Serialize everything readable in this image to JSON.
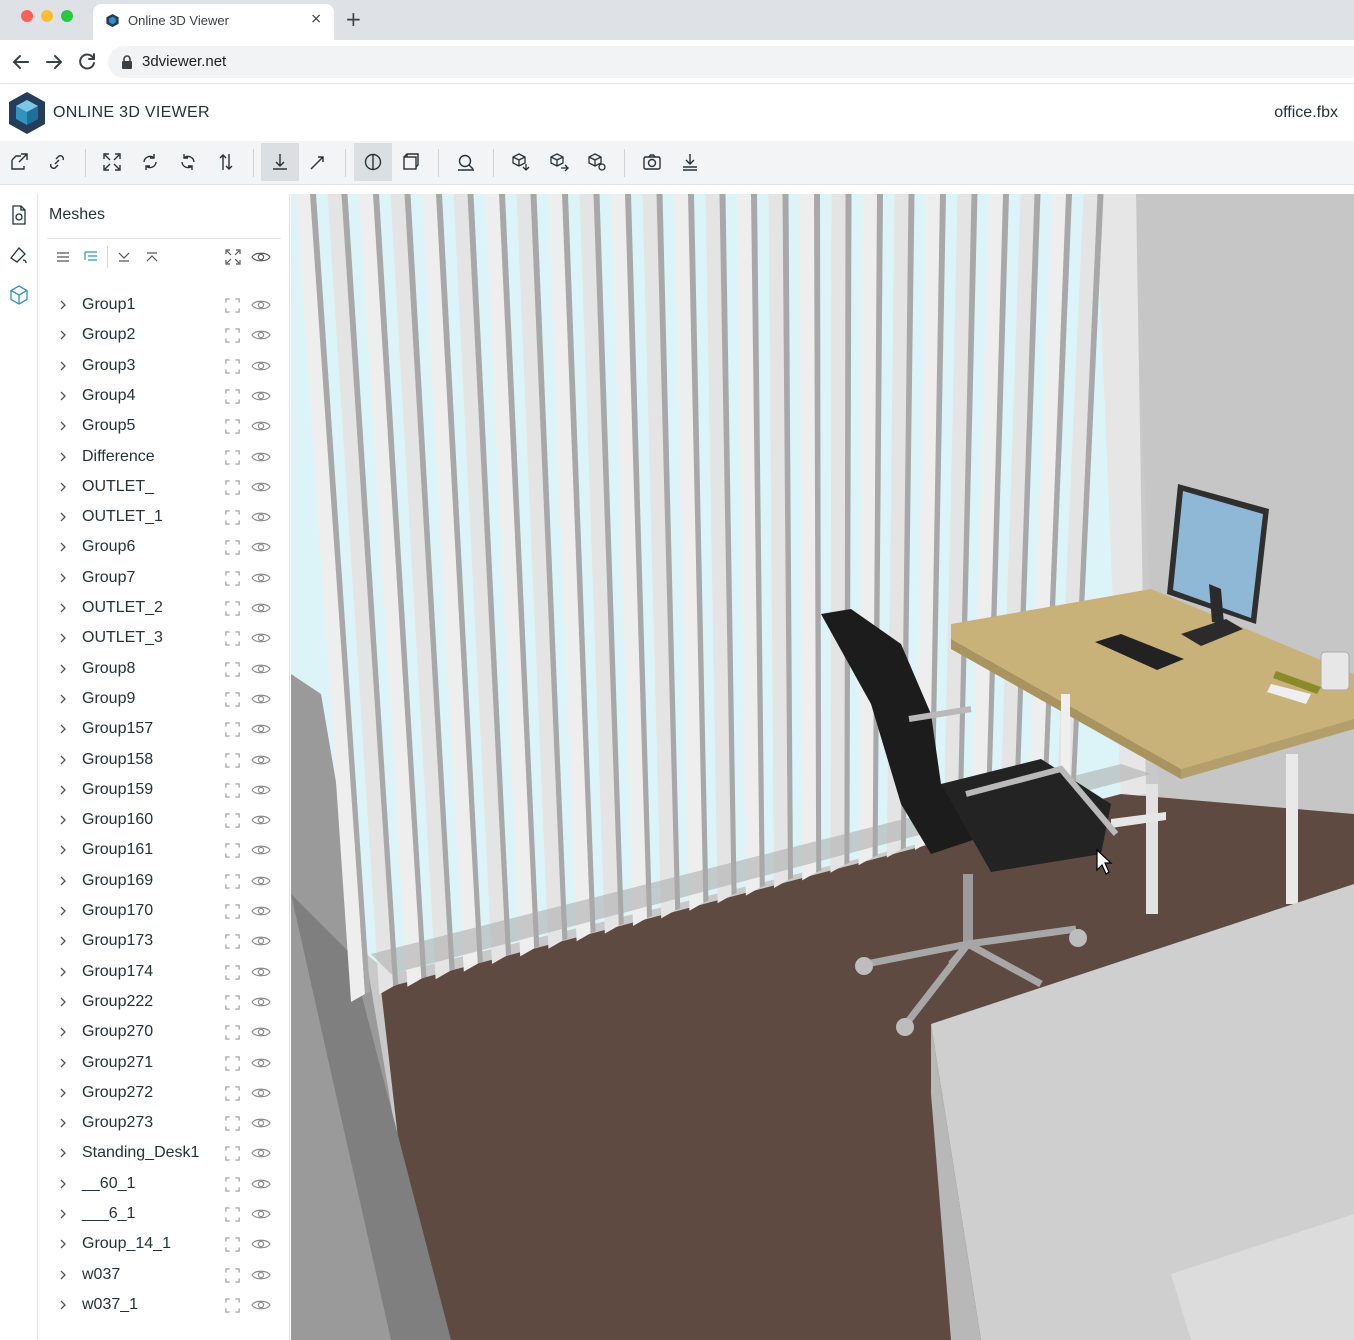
{
  "browser": {
    "tab_title": "Online 3D Viewer",
    "tab_close": "×",
    "new_tab": "+",
    "url": "3dviewer.net"
  },
  "app": {
    "title": "ONLINE 3D VIEWER",
    "file_name": "office.fbx"
  },
  "toolbar": {
    "buttons": [
      {
        "icon": "open-file-icon"
      },
      {
        "icon": "open-url-icon"
      },
      {
        "icon": "fit-to-window-icon"
      },
      {
        "icon": "set-up-vector-icon"
      },
      {
        "icon": "flip-up-vector-icon"
      },
      {
        "icon": "fix-up-vector-icon"
      },
      {
        "icon": "fixed-up-navigation-icon",
        "selected": true
      },
      {
        "icon": "free-orbit-navigation-icon"
      },
      {
        "icon": "perspective-camera-icon",
        "selected": true
      },
      {
        "icon": "orthographic-camera-icon"
      },
      {
        "icon": "measure-icon"
      },
      {
        "icon": "export-model-icon"
      },
      {
        "icon": "share-model-icon"
      },
      {
        "icon": "settings-model-icon"
      },
      {
        "icon": "snapshot-icon"
      },
      {
        "icon": "download-icon"
      }
    ]
  },
  "rail": [
    {
      "icon": "file-details-icon"
    },
    {
      "icon": "materials-icon"
    },
    {
      "icon": "meshes-icon",
      "active": true
    }
  ],
  "panel": {
    "title": "Meshes",
    "tools": [
      {
        "icon": "flat-list-icon"
      },
      {
        "icon": "tree-view-icon"
      },
      {
        "icon": "expand-all-icon"
      },
      {
        "icon": "collapse-all-icon"
      },
      {
        "icon": "fit-all-icon"
      },
      {
        "icon": "show-all-icon"
      }
    ],
    "items": [
      "Group1",
      "Group2",
      "Group3",
      "Group4",
      "Group5",
      "Difference",
      "OUTLET_",
      "OUTLET_1",
      "Group6",
      "Group7",
      "OUTLET_2",
      "OUTLET_3",
      "Group8",
      "Group9",
      "Group157",
      "Group158",
      "Group159",
      "Group160",
      "Group161",
      "Group169",
      "Group170",
      "Group173",
      "Group174",
      "Group222",
      "Group270",
      "Group271",
      "Group272",
      "Group273",
      "Standing_Desk1",
      "__60_1",
      "___6_1",
      "Group_14_1",
      "w037",
      "w037_1"
    ]
  },
  "colors": {
    "accent_blue": "#3393bd",
    "logo_dark": "#263c5b",
    "floor": "#5e4a40",
    "blind": "#e8e8e8",
    "window_glass": "#dcf4f7",
    "desk_top": "#c9b27a",
    "monitor_screen": "#8fb8d6",
    "chair": "#1c1c1c"
  }
}
